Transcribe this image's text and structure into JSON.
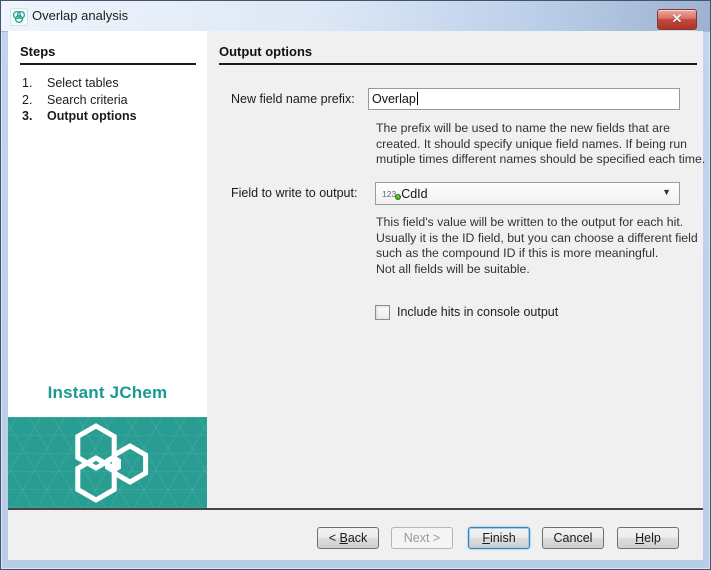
{
  "window": {
    "title": "Overlap analysis"
  },
  "icons": {
    "close_glyph": "✕",
    "dropdown_arrow": "▼"
  },
  "sidebar": {
    "header": "Steps",
    "steps": [
      {
        "num": "1.",
        "label": "Select tables"
      },
      {
        "num": "2.",
        "label": "Search criteria"
      },
      {
        "num": "3.",
        "label": "Output options"
      }
    ],
    "active_step": 3,
    "brand": "Instant JChem"
  },
  "main": {
    "header": "Output options",
    "prefix": {
      "label": "New field name prefix:",
      "value": "Overlap",
      "help": [
        "The prefix will be used to name the new fields that are",
        "created. It should specify unique field names. If being run",
        "mutiple times different names should be specified each time."
      ]
    },
    "output_field": {
      "label": "Field to write to output:",
      "type_icon_text": "123",
      "selected_value": "CdId",
      "help": [
        "This field's value will be written to the output for each hit.",
        "Usually it is the ID field, but you can choose a different field",
        "such as the compound ID if this is more meaningful.",
        "Not all fields will be suitable."
      ]
    },
    "console_checkbox": {
      "label": "Include hits in console output",
      "checked": false
    }
  },
  "buttons": {
    "back": {
      "pre": "< ",
      "mnemonic": "B",
      "post": "ack"
    },
    "next": {
      "pre": "",
      "mnemonic": "",
      "post": "Next >"
    },
    "finish": {
      "pre": "",
      "mnemonic": "F",
      "post": "inish"
    },
    "cancel": {
      "pre": "",
      "mnemonic": "",
      "post": "Cancel"
    },
    "help": {
      "pre": "",
      "mnemonic": "H",
      "post": "elp"
    }
  },
  "colors": {
    "teal_block": "#2a9d93",
    "brand_text": "#189a90",
    "focus_border": "#3c7fb1",
    "close_button_red": "#c0493d",
    "titlebar_blue": "#bccfe9"
  }
}
